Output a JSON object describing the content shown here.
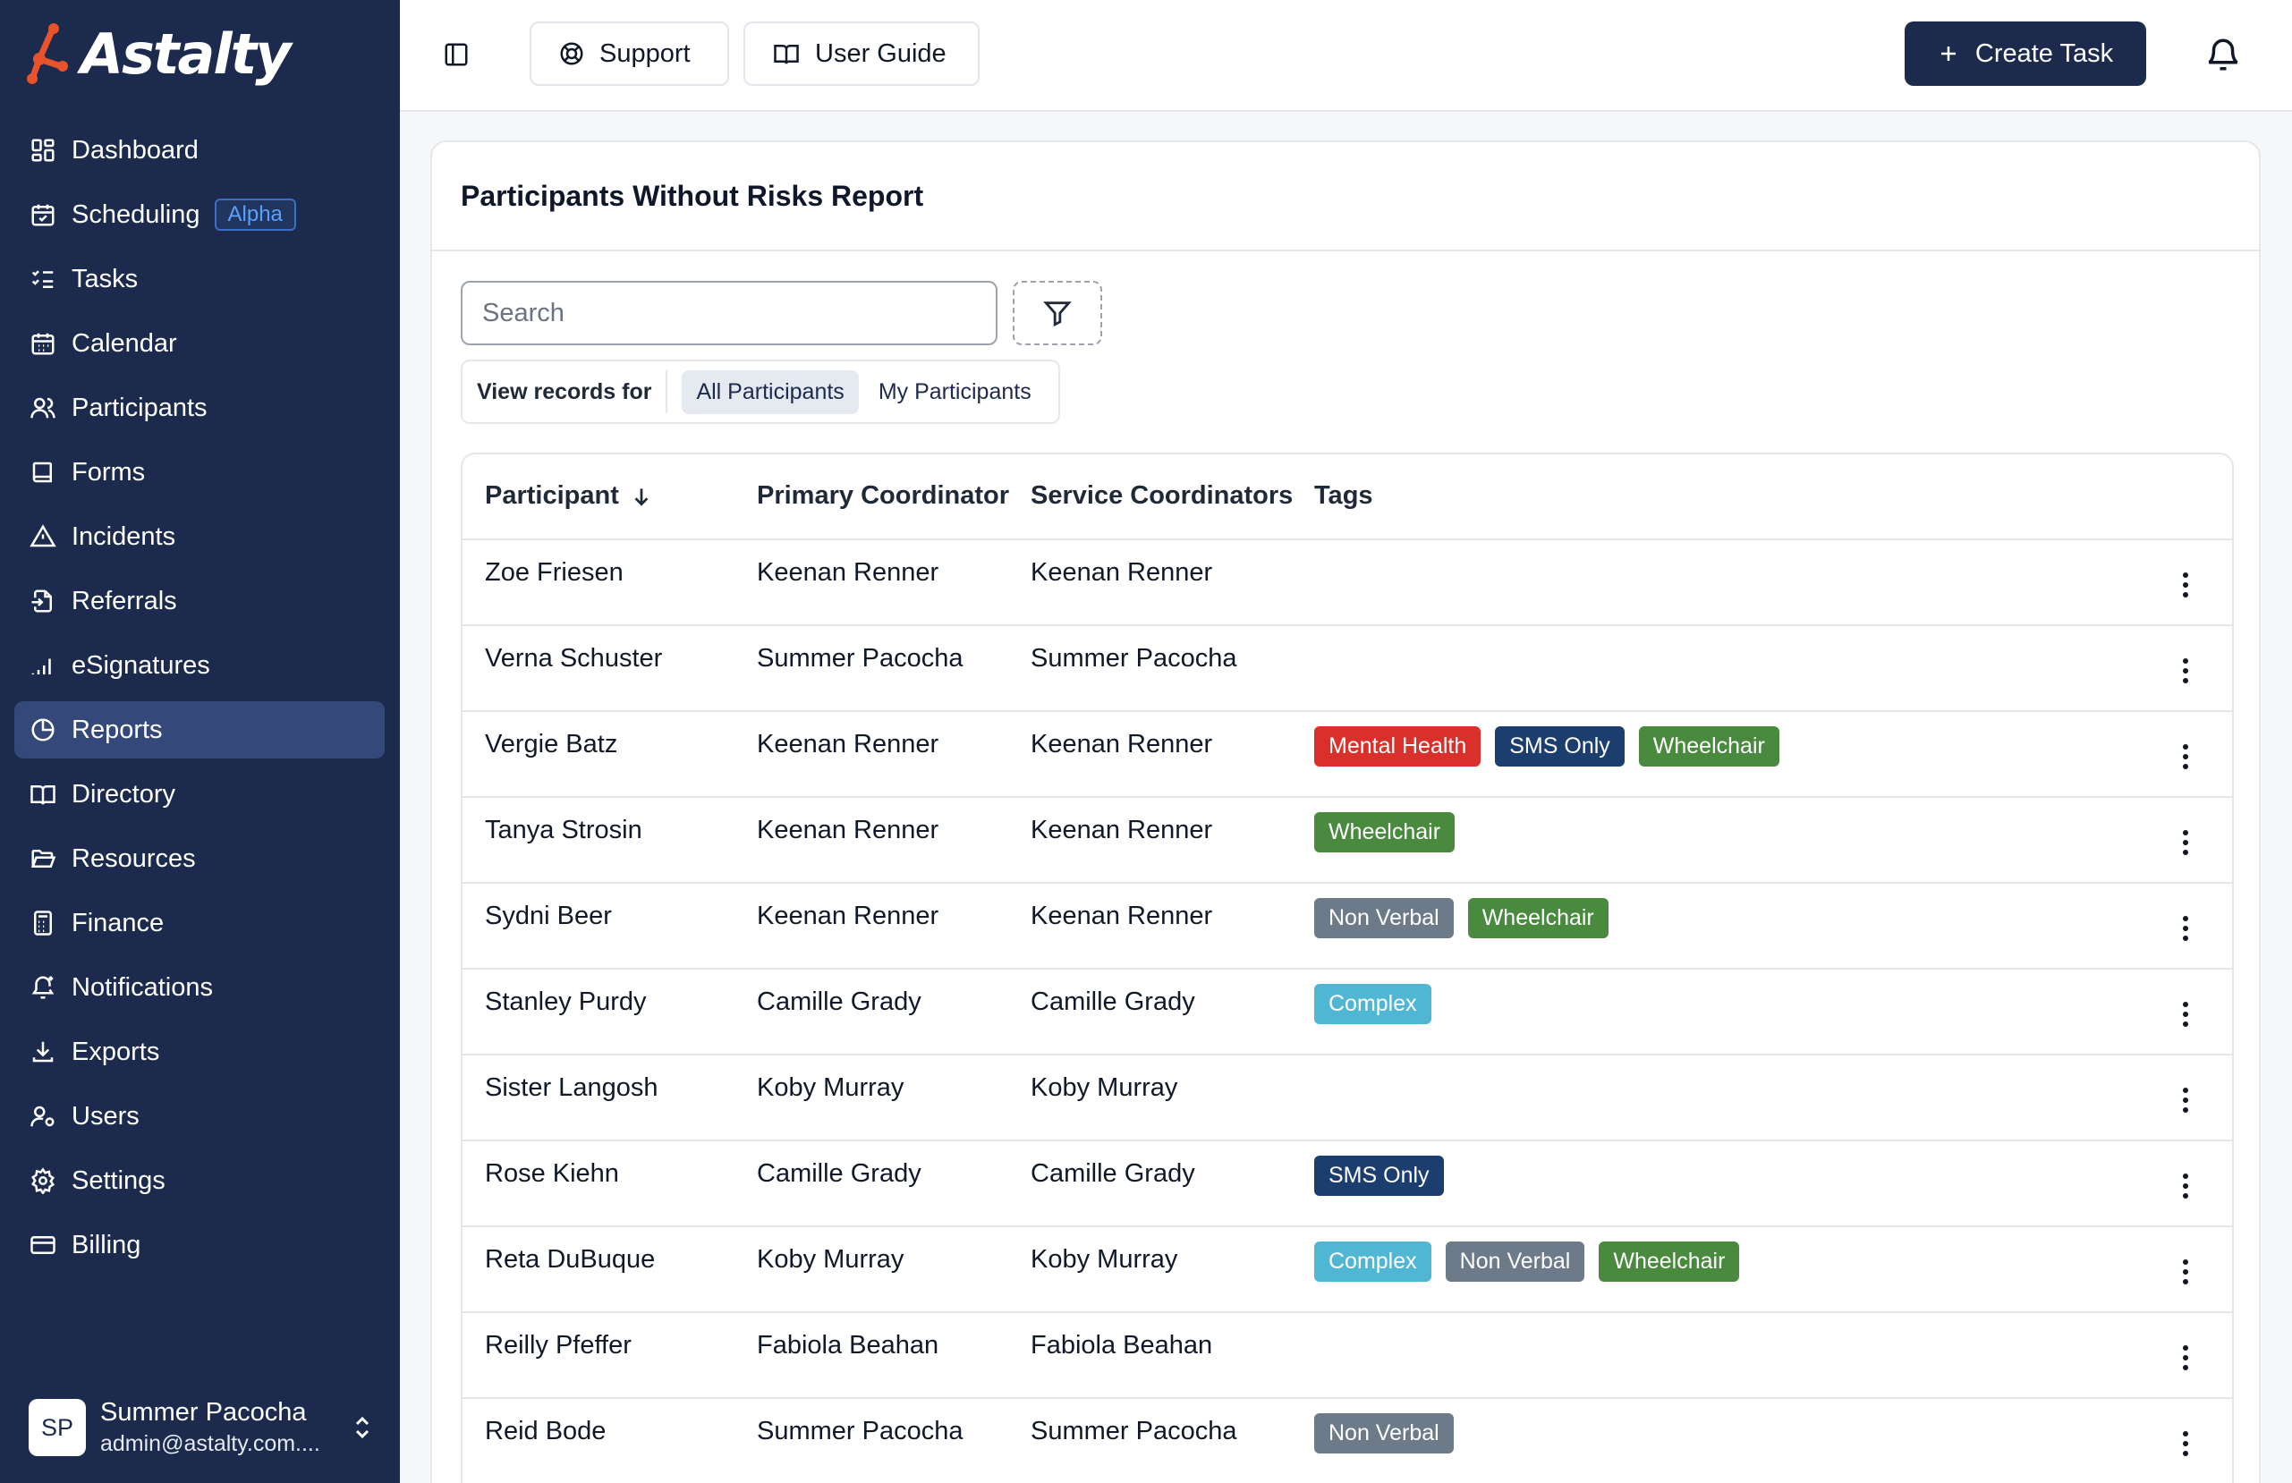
{
  "brand": {
    "name": "Astalty"
  },
  "sidebar": {
    "items": [
      {
        "label": "Dashboard",
        "icon": "dashboard-icon"
      },
      {
        "label": "Scheduling",
        "icon": "calendar-check-icon",
        "badge": "Alpha"
      },
      {
        "label": "Tasks",
        "icon": "list-checks-icon"
      },
      {
        "label": "Calendar",
        "icon": "calendar-icon"
      },
      {
        "label": "Participants",
        "icon": "users-icon"
      },
      {
        "label": "Forms",
        "icon": "book-icon"
      },
      {
        "label": "Incidents",
        "icon": "warning-icon"
      },
      {
        "label": "Referrals",
        "icon": "file-import-icon"
      },
      {
        "label": "eSignatures",
        "icon": "signal-bars-icon"
      },
      {
        "label": "Reports",
        "icon": "pie-chart-icon",
        "active": true
      },
      {
        "label": "Directory",
        "icon": "open-book-icon"
      },
      {
        "label": "Resources",
        "icon": "folder-open-icon"
      },
      {
        "label": "Finance",
        "icon": "calculator-icon"
      },
      {
        "label": "Notifications",
        "icon": "bell-plus-icon"
      },
      {
        "label": "Exports",
        "icon": "download-icon"
      },
      {
        "label": "Users",
        "icon": "user-cog-icon"
      },
      {
        "label": "Settings",
        "icon": "gear-icon"
      },
      {
        "label": "Billing",
        "icon": "credit-card-icon"
      }
    ],
    "user": {
      "initials": "SP",
      "name": "Summer Pacocha",
      "email": "admin@astalty.com...."
    }
  },
  "topbar": {
    "support_label": "Support",
    "guide_label": "User Guide",
    "create_label": "Create Task"
  },
  "report": {
    "title": "Participants Without Risks Report",
    "search_placeholder": "Search",
    "view_label": "View records for",
    "view_options": [
      "All Participants",
      "My Participants"
    ],
    "selected_view": "All Participants",
    "columns": [
      "Participant",
      "Primary Coordinator",
      "Service Coordinators",
      "Tags"
    ],
    "sort_column": "Participant",
    "sort_direction": "descending",
    "rows": [
      {
        "participant": "Zoe Friesen",
        "primary": "Keenan Renner",
        "service": "Keenan Renner",
        "tags": []
      },
      {
        "participant": "Verna Schuster",
        "primary": "Summer Pacocha",
        "service": "Summer Pacocha",
        "tags": []
      },
      {
        "participant": "Vergie Batz",
        "primary": "Keenan Renner",
        "service": "Keenan Renner",
        "tags": [
          "Mental Health",
          "SMS Only",
          "Wheelchair"
        ]
      },
      {
        "participant": "Tanya Strosin",
        "primary": "Keenan Renner",
        "service": "Keenan Renner",
        "tags": [
          "Wheelchair"
        ]
      },
      {
        "participant": "Sydni Beer",
        "primary": "Keenan Renner",
        "service": "Keenan Renner",
        "tags": [
          "Non Verbal",
          "Wheelchair"
        ]
      },
      {
        "participant": "Stanley Purdy",
        "primary": "Camille Grady",
        "service": "Camille Grady",
        "tags": [
          "Complex"
        ]
      },
      {
        "participant": "Sister Langosh",
        "primary": "Koby Murray",
        "service": "Koby Murray",
        "tags": []
      },
      {
        "participant": "Rose Kiehn",
        "primary": "Camille Grady",
        "service": "Camille Grady",
        "tags": [
          "SMS Only"
        ]
      },
      {
        "participant": "Reta DuBuque",
        "primary": "Koby Murray",
        "service": "Koby Murray",
        "tags": [
          "Complex",
          "Non Verbal",
          "Wheelchair"
        ]
      },
      {
        "participant": "Reilly Pfeffer",
        "primary": "Fabiola Beahan",
        "service": "Fabiola Beahan",
        "tags": []
      },
      {
        "participant": "Reid Bode",
        "primary": "Summer Pacocha",
        "service": "Summer Pacocha",
        "tags": [
          "Non Verbal"
        ]
      }
    ]
  },
  "tag_colors": {
    "Mental Health": "#d9302c",
    "SMS Only": "#1c3e6e",
    "Wheelchair": "#4a8a3f",
    "Non Verbal": "#6c7a89",
    "Complex": "#4fb7d4"
  },
  "colors": {
    "sidebar": "#1c2b4d",
    "sidebar_active": "#34497a",
    "primary_button": "#1c2b4d"
  }
}
